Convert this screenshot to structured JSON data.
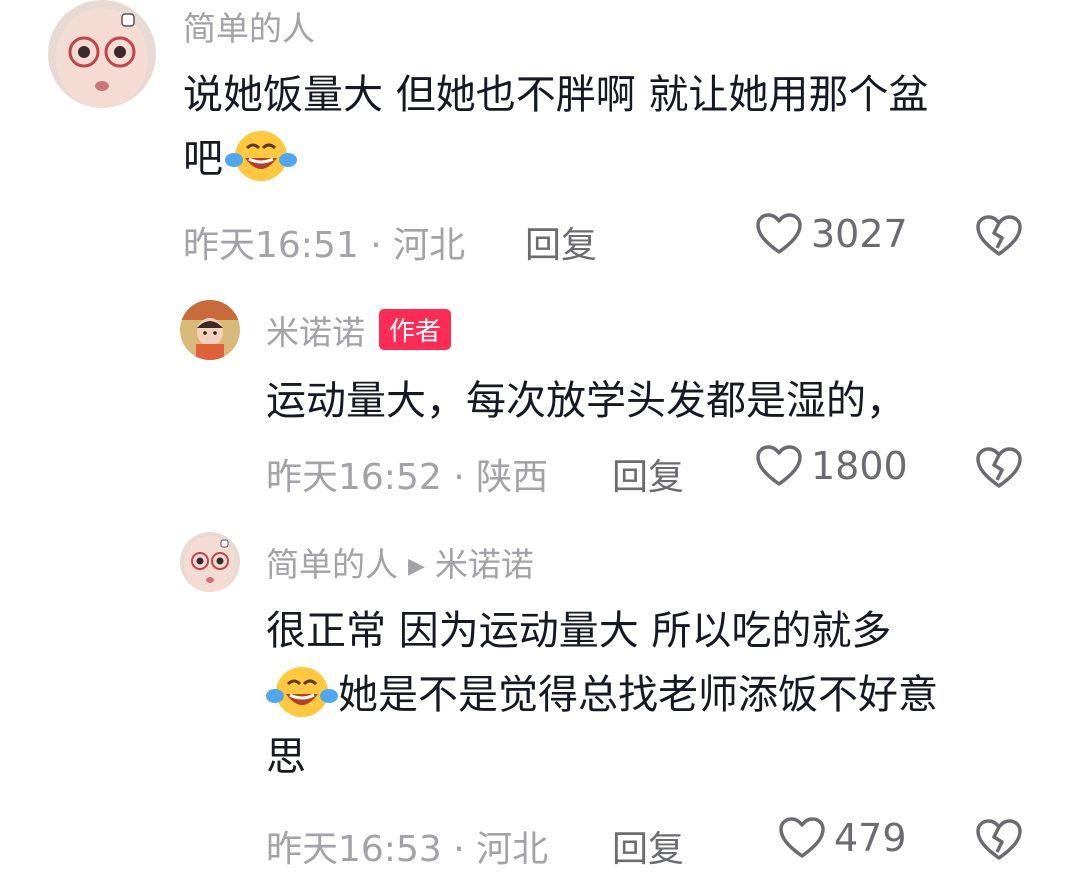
{
  "comments": [
    {
      "author": "简单的人",
      "text_line1": "说她饭量大 但她也不胖啊 就让她用那个盆",
      "text_line2": "吧",
      "time": "昨天16:51",
      "location": "河北",
      "reply_label": "回复",
      "likes": "3027"
    },
    {
      "author": "米诺诺",
      "badge": "作者",
      "text_line1": "运动量大，每次放学头发都是湿的，",
      "time": "昨天16:52",
      "location": "陕西",
      "reply_label": "回复",
      "likes": "1800"
    },
    {
      "author": "简单的人",
      "reply_to": "米诺诺",
      "text_line1": "很正常 因为运动量大 所以吃的就多",
      "text_line2": "她是不是觉得总找老师添饭不好意",
      "text_line3": "思",
      "time": "昨天16:53",
      "location": "河北",
      "reply_label": "回复",
      "likes": "479"
    }
  ],
  "icons": {
    "like": "heart-outline-icon",
    "dislike": "broken-heart-icon",
    "emoji": "tears-of-joy-emoji"
  },
  "colors": {
    "badge": "#fe2c55",
    "meta_gray": "#a2a2a8",
    "text": "#161823"
  }
}
